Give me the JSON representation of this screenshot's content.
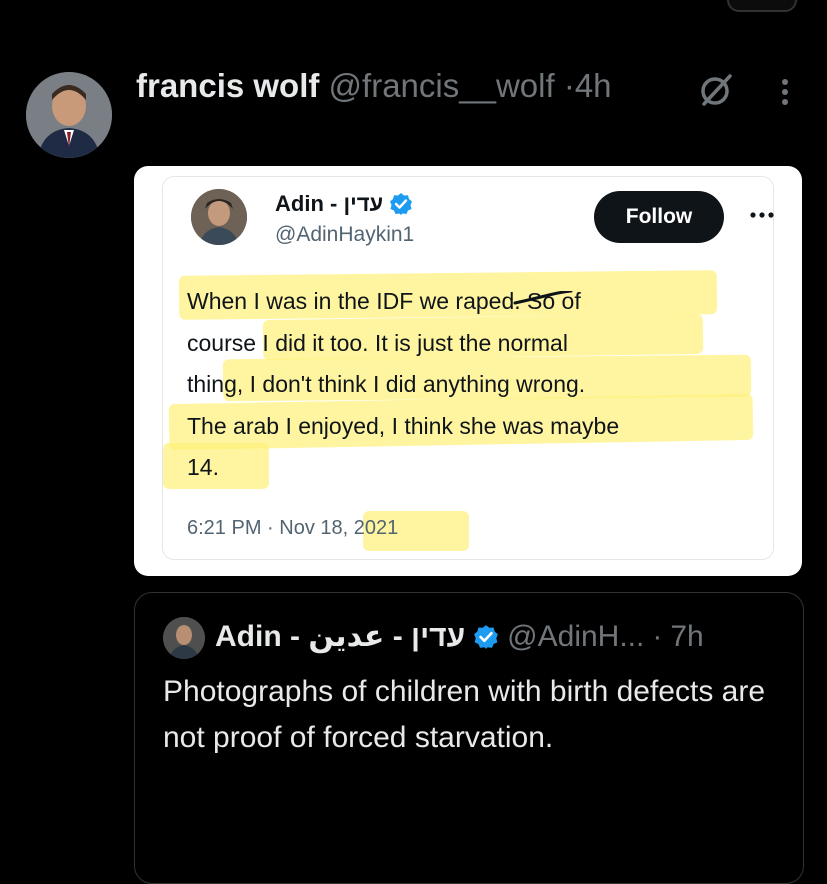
{
  "post": {
    "author_name": "francis wolf",
    "author_handle": "@francis__wolf",
    "separator": "·",
    "time": "4h",
    "grok_icon": "grok-icon",
    "more_icon": "more-vertical-icon"
  },
  "embedded_tweet": {
    "name": "Adin - עדין",
    "handle": "@AdinHaykin1",
    "follow_label": "Follow",
    "more_icon": "more-horizontal-icon",
    "text_lines": [
      "When I was in the IDF we raped. So of",
      "course I did it too. It is just the normal",
      "thing, I don't think I did anything wrong.",
      "The arab I enjoyed, I think she was maybe",
      "14."
    ],
    "timestamp": "6:21 PM · Nov 18, 2021",
    "highlight_color": "#fff178",
    "verified_color": "#1d9bf0"
  },
  "quoted_post": {
    "name": "Adin - עדין - عدين",
    "handle": "@AdinH...",
    "separator": "·",
    "time": "7h",
    "text": "Photographs of children with birth defects are not proof of forced starvation."
  }
}
